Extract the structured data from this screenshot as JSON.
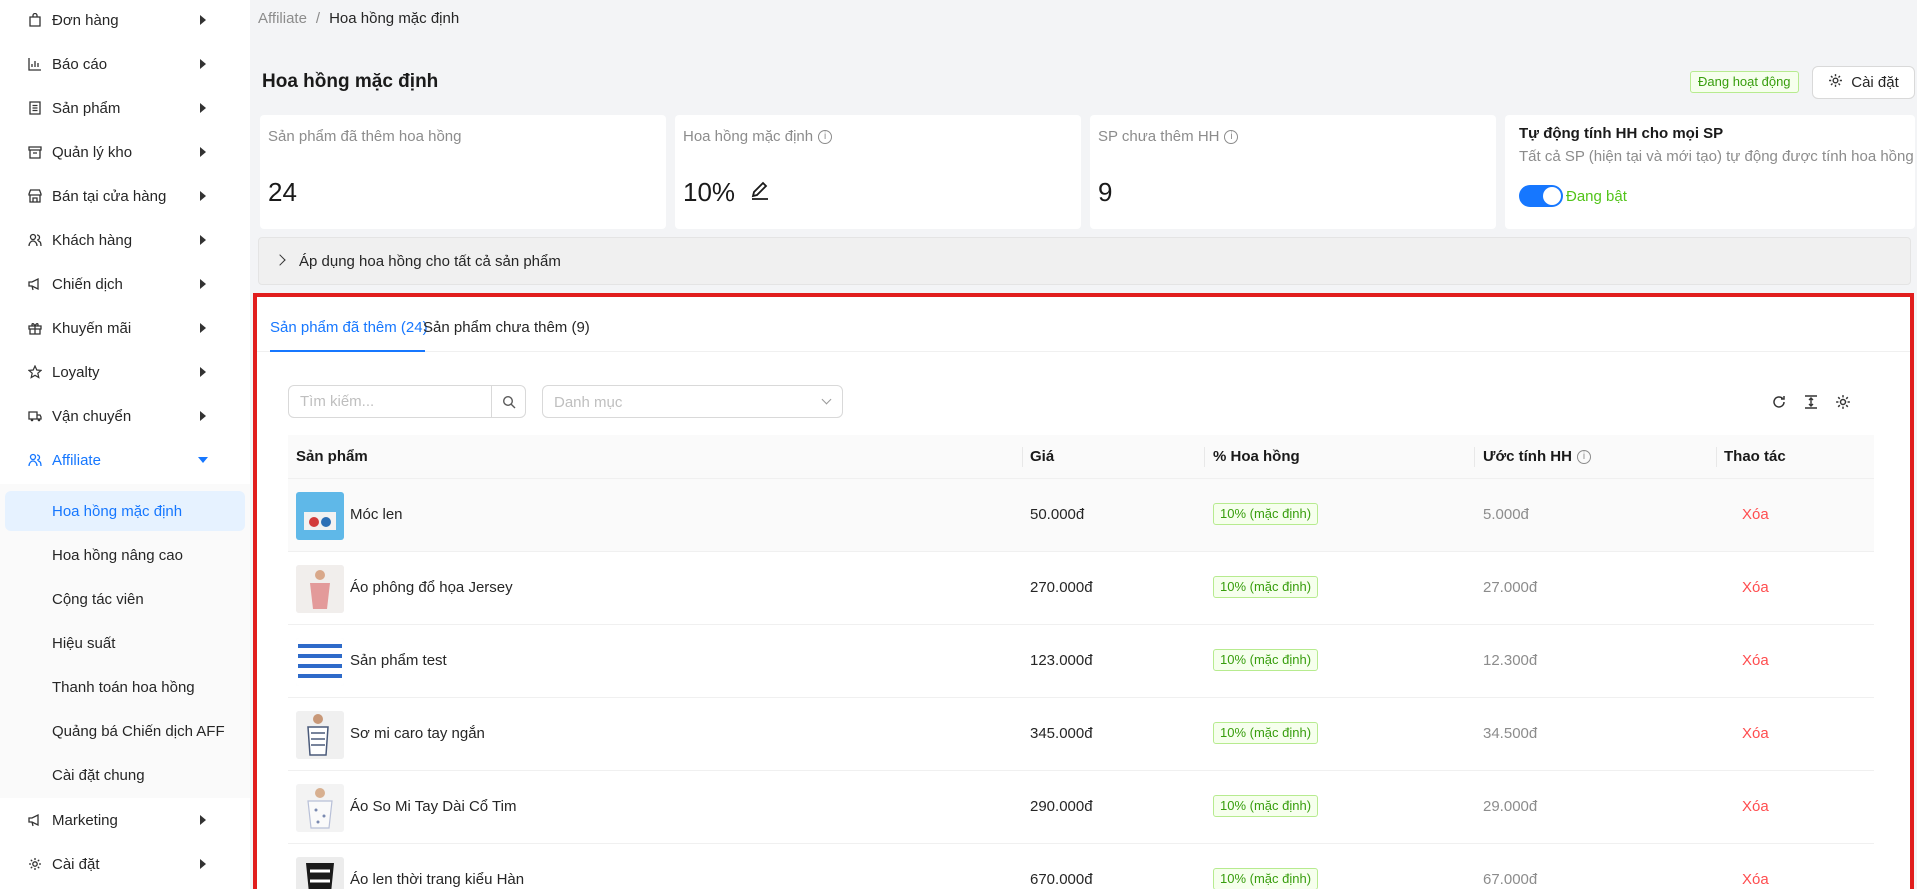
{
  "colors": {
    "accent": "#1677ff",
    "success": "#52c41a",
    "danger": "#ff4d4f",
    "highlight_border": "#e11d1d"
  },
  "sidebar": {
    "items": [
      {
        "label": "Đơn hàng",
        "icon": "bag-icon"
      },
      {
        "label": "Báo cáo",
        "icon": "chart-icon"
      },
      {
        "label": "Sản phẩm",
        "icon": "list-icon"
      },
      {
        "label": "Quản lý kho",
        "icon": "box-icon"
      },
      {
        "label": "Bán tại cửa hàng",
        "icon": "store-icon"
      },
      {
        "label": "Khách hàng",
        "icon": "users-icon"
      },
      {
        "label": "Chiến dịch",
        "icon": "megaphone-icon"
      },
      {
        "label": "Khuyến mãi",
        "icon": "gift-icon"
      },
      {
        "label": "Loyalty",
        "icon": "star-icon"
      },
      {
        "label": "Vận chuyển",
        "icon": "truck-icon"
      },
      {
        "label": "Affiliate",
        "icon": "affiliate-icon"
      },
      {
        "label": "Marketing",
        "icon": "megaphone-icon"
      },
      {
        "label": "Cài đặt",
        "icon": "gear-icon"
      }
    ],
    "affiliate_sub": [
      "Hoa hồng mặc định",
      "Hoa hồng nâng cao",
      "Cộng tác viên",
      "Hiệu suất",
      "Thanh toán hoa hồng",
      "Quảng bá Chiến dịch AFF",
      "Cài đặt chung"
    ]
  },
  "breadcrumb": {
    "parent": "Affiliate",
    "separator": "/",
    "current": "Hoa hồng mặc định"
  },
  "header": {
    "title": "Hoa hồng mặc định",
    "status": "Đang hoạt động",
    "settings_label": "Cài đặt"
  },
  "stats": {
    "added": {
      "label": "Sản phẩm đã thêm hoa hồng",
      "value": "24"
    },
    "default_rate": {
      "label": "Hoa hồng mặc định",
      "value": "10%"
    },
    "not_added": {
      "label": "SP chưa thêm HH",
      "value": "9"
    },
    "auto": {
      "title": "Tự động tính HH cho mọi SP",
      "description": "Tất cả SP (hiện tại và mới tạo) tự động được tính hoa hồng",
      "toggle_label": "Đang bật",
      "enabled": true
    }
  },
  "apply_all_label": "Áp dụng hoa hồng cho tất cả sản phẩm",
  "tabs": [
    {
      "label": "Sản phẩm đã thêm (24)",
      "active": true
    },
    {
      "label": "Sản phẩm chưa thêm (9)",
      "active": false
    }
  ],
  "filters": {
    "search_placeholder": "Tìm kiếm...",
    "category_placeholder": "Danh mục"
  },
  "table": {
    "columns": [
      "Sản phẩm",
      "Giá",
      "% Hoa hồng",
      "Ước tính HH",
      "Thao tác"
    ],
    "rows": [
      {
        "name": "Móc len",
        "price": "50.000đ",
        "commission": "10% (mặc định)",
        "estimate": "5.000đ",
        "action": "Xóa"
      },
      {
        "name": "Áo phông đổ họa Jersey",
        "price": "270.000đ",
        "commission": "10% (mặc định)",
        "estimate": "27.000đ",
        "action": "Xóa"
      },
      {
        "name": "Sản phẩm test",
        "price": "123.000đ",
        "commission": "10% (mặc định)",
        "estimate": "12.300đ",
        "action": "Xóa"
      },
      {
        "name": "Sơ mi caro tay ngắn",
        "price": "345.000đ",
        "commission": "10% (mặc định)",
        "estimate": "34.500đ",
        "action": "Xóa"
      },
      {
        "name": "Áo So Mi Tay Dài Cổ Tim",
        "price": "290.000đ",
        "commission": "10% (mặc định)",
        "estimate": "29.000đ",
        "action": "Xóa"
      },
      {
        "name": "Áo len thời trang kiểu Hàn",
        "price": "670.000đ",
        "commission": "10% (mặc định)",
        "estimate": "67.000đ",
        "action": "Xóa"
      }
    ]
  }
}
